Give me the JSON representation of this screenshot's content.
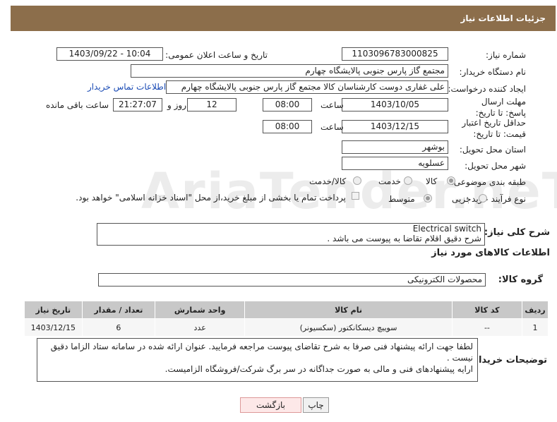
{
  "header": {
    "title": "جزئیات اطلاعات نیاز"
  },
  "watermark": "AriaTender.neT",
  "fields": {
    "need_number_label": "شماره نیاز:",
    "need_number": "1103096783000825",
    "announce_label": "تاریخ و ساعت اعلان عمومی:",
    "announce_value": "1403/09/22 - 10:04",
    "buyer_org_label": "نام دستگاه خریدار:",
    "buyer_org": "مجتمع گاز پارس جنوبی  پالایشگاه چهارم",
    "creator_label": "ایجاد کننده درخواست:",
    "creator": "علی غفاری دوست کارشناسان کالا مجتمع گاز پارس جنوبی  پالایشگاه چهارم",
    "contact_link": "اطلاعات تماس خریدار",
    "deadline_label": "مهلت ارسال پاسخ: تا تاریخ:",
    "deadline_date": "1403/10/05",
    "time_label": "ساعت",
    "deadline_time": "08:00",
    "days_value": "12",
    "days_label": "روز و",
    "remaining_time": "21:27:07",
    "remaining_label": "ساعت باقی مانده",
    "validity_label": "حداقل تاریخ اعتبار قیمت: تا تاریخ:",
    "validity_date": "1403/12/15",
    "validity_time": "08:00",
    "province_label": "استان محل تحویل:",
    "province": "بوشهر",
    "city_label": "شهر محل تحویل:",
    "city": "عسلویه",
    "category_label": "طبقه بندی موضوعی:",
    "category_options": [
      "کالا",
      "خدمت",
      "کالا/خدمت"
    ],
    "process_label": "نوع فرآیند خرید :",
    "process_options": [
      "جزیی",
      "متوسط"
    ],
    "payment_note": "پرداخت تمام یا بخشی از مبلغ خرید،از محل \"اسناد خزانه اسلامی\" خواهد بود."
  },
  "description": {
    "label": "شرح کلی نیاز:",
    "line1": "Electrical switch",
    "line2": "شرح دقیق اقلام تقاضا به پیوست می باشد ."
  },
  "goods_info_title": "اطلاعات کالاهای مورد نیاز",
  "goods_group": {
    "label": "گروه کالا:",
    "value": "محصولات الکترونیکی"
  },
  "table": {
    "headers": [
      "ردیف",
      "کد کالا",
      "نام کالا",
      "واحد شمارش",
      "تعداد / مقدار",
      "تاریخ نیاز"
    ],
    "rows": [
      [
        "1",
        "--",
        "سوییچ دیسکانکتور (سکسیونر)",
        "عدد",
        "6",
        "1403/12/15"
      ]
    ]
  },
  "buyer_notes": {
    "label": "توضیحات خریدار:",
    "line1": "لطفا جهت ارائه پیشنهاد فنی صرفا به شرح تقاضای پیوست مراجعه فرمایید. عنوان ارائه شده در سامانه ستاد الزاما دقیق",
    "line2": "نیست .",
    "line3": "ارایه پیشنهادهای فنی و مالی به صورت جداگانه در سر برگ شرکت/فروشگاه الزامیست."
  },
  "buttons": {
    "print": "چاپ",
    "back": "بازگشت"
  }
}
